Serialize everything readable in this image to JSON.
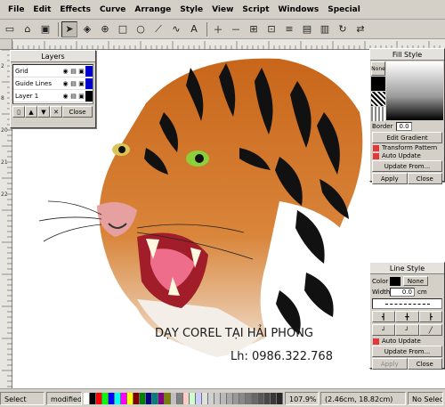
{
  "menubar": {
    "items": [
      "File",
      "Edit",
      "Effects",
      "Curve",
      "Arrange",
      "Style",
      "View",
      "Script",
      "Windows",
      "Special"
    ]
  },
  "toolbar": {
    "tools": [
      "arrow-select-icon",
      "edit-node-icon",
      "zoom-icon",
      "rectangle-icon",
      "ellipse-icon",
      "polyline-icon",
      "bezier-icon",
      "text-icon"
    ]
  },
  "layers_panel": {
    "title": "Layers",
    "rows": [
      {
        "name": "Grid",
        "color": "#0000cc"
      },
      {
        "name": "Guide Lines",
        "color": "#0000cc"
      },
      {
        "name": "Layer 1",
        "color": "#000000"
      }
    ],
    "close_label": "Close"
  },
  "fill_panel": {
    "title": "Fill Style",
    "none_label": "None",
    "border_label": "Border",
    "border_value": "0.0",
    "edit_gradient_label": "Edit Gradient",
    "transform_pattern_label": "Transform Pattern",
    "auto_update_label": "Auto Update",
    "update_from_label": "Update From...",
    "apply_label": "Apply",
    "close_label": "Close"
  },
  "line_panel": {
    "title": "Line Style",
    "color_label": "Color",
    "none_label": "None",
    "width_label": "Width",
    "width_value": "0.0",
    "width_unit": "cm",
    "auto_update_label": "Auto Update",
    "update_from_label": "Update From...",
    "apply_label": "Apply",
    "close_label": "Close"
  },
  "canvas_text": {
    "line1": "DẠY COREL TẠI HẢI PHÒNG",
    "line2": "Lh: 0986.322.768"
  },
  "status": {
    "mode": "Select",
    "modified": "modified",
    "zoom": "107.9%",
    "coords": "(2.46cm, 18.82cm)",
    "selection": "No Selection"
  },
  "ruler_v_labels": [
    "2",
    "8",
    "20",
    "21",
    "22"
  ],
  "palette_colors": [
    "#ffffff",
    "#000000",
    "#ff0000",
    "#00ff00",
    "#0000ff",
    "#00ffff",
    "#ff00ff",
    "#ffff00",
    "#800000",
    "#008000",
    "#000080",
    "#008080",
    "#800080",
    "#808000",
    "#c0c0c0",
    "#808080",
    "#ffcccc",
    "#ccffcc",
    "#ccccff",
    "#e0e0e0",
    "#d0d0d0",
    "#c8c8c8",
    "#b8b8b8",
    "#a8a8a8",
    "#989898",
    "#888888",
    "#787878",
    "#686868",
    "#585858",
    "#484848",
    "#383838",
    "#282828"
  ]
}
